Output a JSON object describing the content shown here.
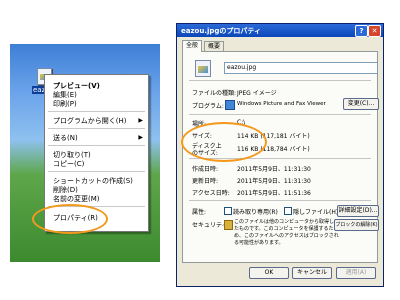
{
  "desktop": {
    "file_label": "eazou",
    "menu": {
      "preview": "プレビュー(V)",
      "edit": "編集(E)",
      "print": "印刷(P)",
      "open_with": "プログラムから開く(H)",
      "send_to": "送る(N)",
      "cut": "切り取り(T)",
      "copy": "コピー(C)",
      "create_shortcut": "ショートカットの作成(S)",
      "delete": "削除(D)",
      "rename": "名前の変更(M)",
      "properties": "プロパティ(R)"
    },
    "submenu_arrow": "▶"
  },
  "dialog": {
    "title": "eazou.jpgのプロパティ",
    "tabs": [
      "全般",
      "概要"
    ],
    "filename": "eazou.jpg",
    "file_type_label": "ファイルの種類:",
    "file_type_value": "JPEG イメージ",
    "program_label": "プログラム:",
    "program_value": "Windows Picture and Fax Viewer",
    "change_button": "変更(C)...",
    "location_label": "場所:",
    "location_value": "C:\\",
    "size_label": "サイズ:",
    "size_value": "114 KB (117,181 バイト)",
    "disk_size_label_1": "ディスク上",
    "disk_size_label_2": "のサイズ:",
    "disk_size_value": "116 KB (118,784 バイト)",
    "created_label": "作成日時:",
    "created_value": "2011年5月9日、11:31:30",
    "modified_label": "更新日時:",
    "modified_value": "2011年5月9日、11:31:30",
    "accessed_label": "アクセス日時:",
    "accessed_value": "2011年5月9日、11:51:36",
    "attributes_label": "属性:",
    "readonly_label": "読み取り専用(R)",
    "hidden_label": "隠しファイル(H)",
    "advanced_button": "詳細設定(D)...",
    "security_label": "セキュリティ:",
    "security_text_1": "このファイルは他のコンピュータから取得し",
    "security_text_2": "たものです。このコンピュータを保護するた",
    "security_text_3": "め、このファイルへのアクセスはブロックされ",
    "security_text_4": "る可能性があります。",
    "unblock_button": "ブロックの解除(K)",
    "ok_button": "OK",
    "cancel_button": "キャンセル",
    "apply_button": "適用(A)",
    "help_button": "?",
    "close_button": "✕"
  },
  "colors": {
    "highlight_ring": "#f39a1e",
    "titlebar": "#0b46b8"
  }
}
